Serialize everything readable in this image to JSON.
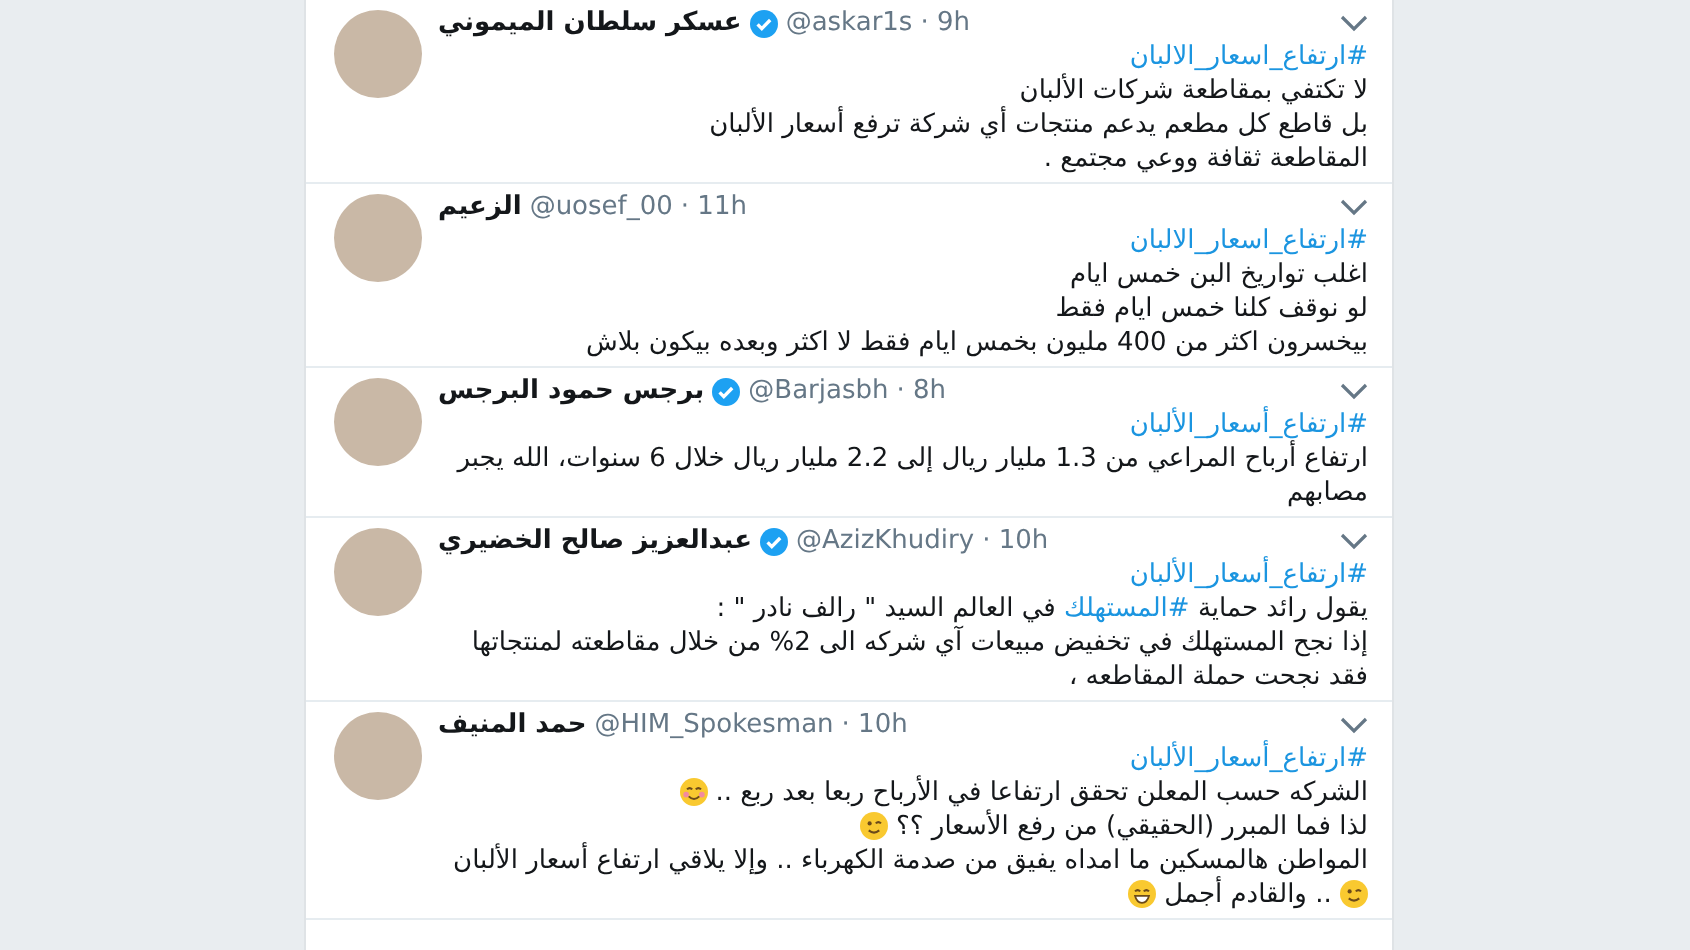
{
  "tweets": [
    {
      "name": "عسكر سلطان الميموني",
      "verified": true,
      "handle": "@askar1s",
      "time": "· 9h",
      "lines": [
        [
          {
            "kind": "hashtag",
            "text": "#ارتفاع_اسعار_الالبان"
          }
        ],
        [
          {
            "kind": "text",
            "text": "لا تكتفي بمقاطعة شركات الألبان"
          }
        ],
        [
          {
            "kind": "text",
            "text": "بل قاطع كل مطعم يدعم منتجات أي شركة ترفع أسعار الألبان"
          }
        ],
        [
          {
            "kind": "text",
            "text": "المقاطعة ثقافة ووعي مجتمع ."
          }
        ]
      ]
    },
    {
      "name": "الزعيم",
      "verified": false,
      "handle": "@uosef_00",
      "time": "· 11h",
      "lines": [
        [
          {
            "kind": "hashtag",
            "text": "#ارتفاع_اسعار_الالبان"
          }
        ],
        [
          {
            "kind": "text",
            "text": "اغلب تواريخ البن خمس ايام"
          }
        ],
        [
          {
            "kind": "text",
            "text": "لو نوقف كلنا خمس ايام فقط"
          }
        ],
        [
          {
            "kind": "text",
            "text": "بيخسرون اكثر من 400 مليون بخمس ايام فقط لا اكثر وبعده بيكون بلاش"
          }
        ]
      ]
    },
    {
      "name": "برجس حمود البرجس",
      "verified": true,
      "handle": "@Barjasbh",
      "time": "· 8h",
      "lines": [
        [
          {
            "kind": "hashtag",
            "text": "#ارتفاع_أسعار_الألبان"
          }
        ],
        [
          {
            "kind": "text",
            "text": "ارتفاع أرباح المراعي من 1.3 مليار ريال إلى 2.2 مليار ريال خلال 6 سنوات، الله يجبر"
          }
        ],
        [
          {
            "kind": "text",
            "text": "مصابهم"
          }
        ]
      ]
    },
    {
      "name": "عبدالعزيز صالح الخضيري",
      "verified": true,
      "handle": "@AzizKhudiry",
      "time": "· 10h",
      "lines": [
        [
          {
            "kind": "hashtag",
            "text": "#ارتفاع_أسعار_الألبان"
          }
        ],
        [
          {
            "kind": "text",
            "text": "يقول رائد حماية"
          },
          {
            "kind": "hashtag",
            "text": "#المستهلك"
          },
          {
            "kind": "text",
            "text": "في العالم السيد \" رالف نادر \" :"
          }
        ],
        [
          {
            "kind": "text",
            "text": "إذا نجح المستهلك في تخفيض مبيعات آي شركه الى 2%  من خلال مقاطعته لمنتجاتها"
          }
        ],
        [
          {
            "kind": "text",
            "text": "فقد نجحت حملة المقاطعه ،"
          }
        ]
      ]
    },
    {
      "name": "حمد المنيف",
      "verified": false,
      "handle": "@HIM_Spokesman",
      "time": "· 10h",
      "lines": [
        [
          {
            "kind": "hashtag",
            "text": "#ارتفاع_أسعار_الألبان"
          }
        ],
        [
          {
            "kind": "text",
            "text": "الشركه حسب المعلن تحقق ارتفاعا في الأرباح ربعا بعد ربع .."
          },
          {
            "kind": "smile"
          }
        ],
        [
          {
            "kind": "text",
            "text": "لذا فما المبرر (الحقيقي) من رفع الأسعار ؟؟"
          },
          {
            "kind": "wink"
          }
        ],
        [
          {
            "kind": "text",
            "text": "المواطن هالمسكين ما امداه يفيق من صدمة الكهرباء .. وإلا يلاقي ارتفاع أسعار الألبان"
          }
        ],
        [
          {
            "kind": "wink"
          },
          {
            "kind": "text",
            "text": ".. والقادم أجمل"
          },
          {
            "kind": "grin"
          }
        ]
      ]
    }
  ]
}
